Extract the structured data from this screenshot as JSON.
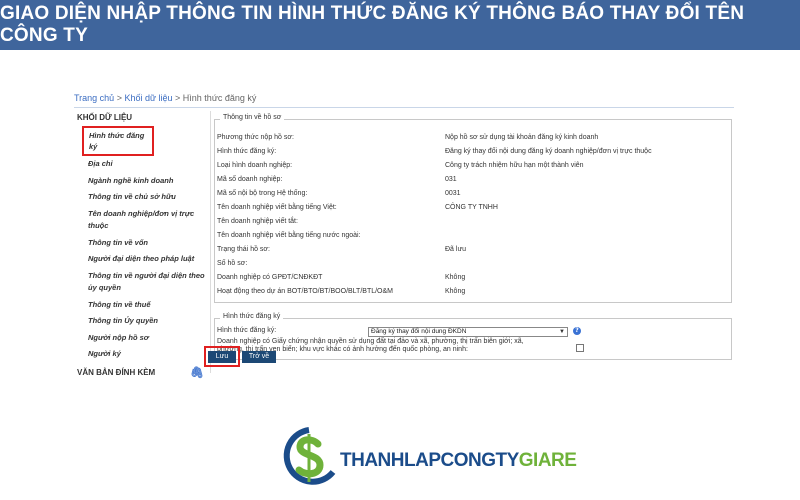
{
  "banner": {
    "title": "GIAO DIỆN NHẬP THÔNG TIN HÌNH THỨC ĐĂNG KÝ THÔNG BÁO THAY ĐỔI TÊN CÔNG TY"
  },
  "breadcrumb": {
    "home": "Trang chủ",
    "sep": " > ",
    "data": "Khối dữ liệu",
    "current": "Hình thức đăng ký"
  },
  "sidebar": {
    "heading": "KHỐI DỮ LIỆU",
    "items": [
      {
        "label": "Hình thức đăng ký"
      },
      {
        "label": "Địa chỉ"
      },
      {
        "label": "Ngành nghề kinh doanh"
      },
      {
        "label": "Thông tin về chủ sở hữu"
      },
      {
        "label": "Tên doanh nghiệp/đơn vị trực thuộc"
      },
      {
        "label": "Thông tin về vốn"
      },
      {
        "label": "Người đại diện theo pháp luật"
      },
      {
        "label": "Thông tin về người đại diện theo ủy quyền"
      },
      {
        "label": "Thông tin về thuế"
      },
      {
        "label": "Thông tin Ủy quyền"
      },
      {
        "label": "Người nộp hồ sơ"
      },
      {
        "label": "Người ký"
      }
    ],
    "attachments": "VĂN BẢN ĐÍNH KÈM",
    "attach_icon": "paperclip-icon"
  },
  "info": {
    "legend": "Thông tin về hồ sơ",
    "rows": [
      {
        "label": "Phương thức nộp hồ sơ:",
        "value": "Nộp hồ sơ sử dụng tài khoản đăng ký kinh doanh"
      },
      {
        "label": "Hình thức đăng ký:",
        "value": "Đăng ký thay đổi nội dung đăng ký doanh nghiệp/đơn vị trực thuộc"
      },
      {
        "label": "Loại hình doanh nghiệp:",
        "value": "Công ty trách nhiệm hữu hạn một thành viên"
      },
      {
        "label": "Mã số doanh nghiệp:",
        "value": "031"
      },
      {
        "label": "Mã số nội bộ trong Hệ thống:",
        "value": "0031"
      },
      {
        "label": "Tên doanh nghiệp viết bằng tiếng Việt:",
        "value": "CÔNG TY TNHH"
      },
      {
        "label": "Tên doanh nghiệp viết tắt:",
        "value": ""
      },
      {
        "label": "Tên doanh nghiệp viết bằng tiếng nước ngoài:",
        "value": ""
      },
      {
        "label": "Trạng thái hồ sơ:",
        "value": "Đã lưu"
      },
      {
        "label": "Số hồ sơ:",
        "value": ""
      },
      {
        "label": "Doanh nghiệp có GPĐT/CNĐKĐT",
        "value": "Không"
      },
      {
        "label": "Hoạt động theo dự án BOT/BTO/BT/BOO/BLT/BTL/O&M",
        "value": "Không"
      }
    ]
  },
  "registration": {
    "legend": "Hình thức đăng ký",
    "type_label": "Hình thức đăng ký:",
    "type_value": "Đăng ký thay đổi nội dung ĐKDN",
    "land_label": "Doanh nghiệp có Giấy chứng nhận quyền sử dụng đất tại đảo và xã, phường, thị trấn biên giới; xã, phường, thị trấn ven biển; khu vực khác có ảnh hưởng đến quốc phòng, an ninh:"
  },
  "buttons": {
    "save": "Lưu",
    "back": "Trở về"
  },
  "logo": {
    "part1": "THANHLAPCONGTY",
    "part2": "GIARE"
  }
}
